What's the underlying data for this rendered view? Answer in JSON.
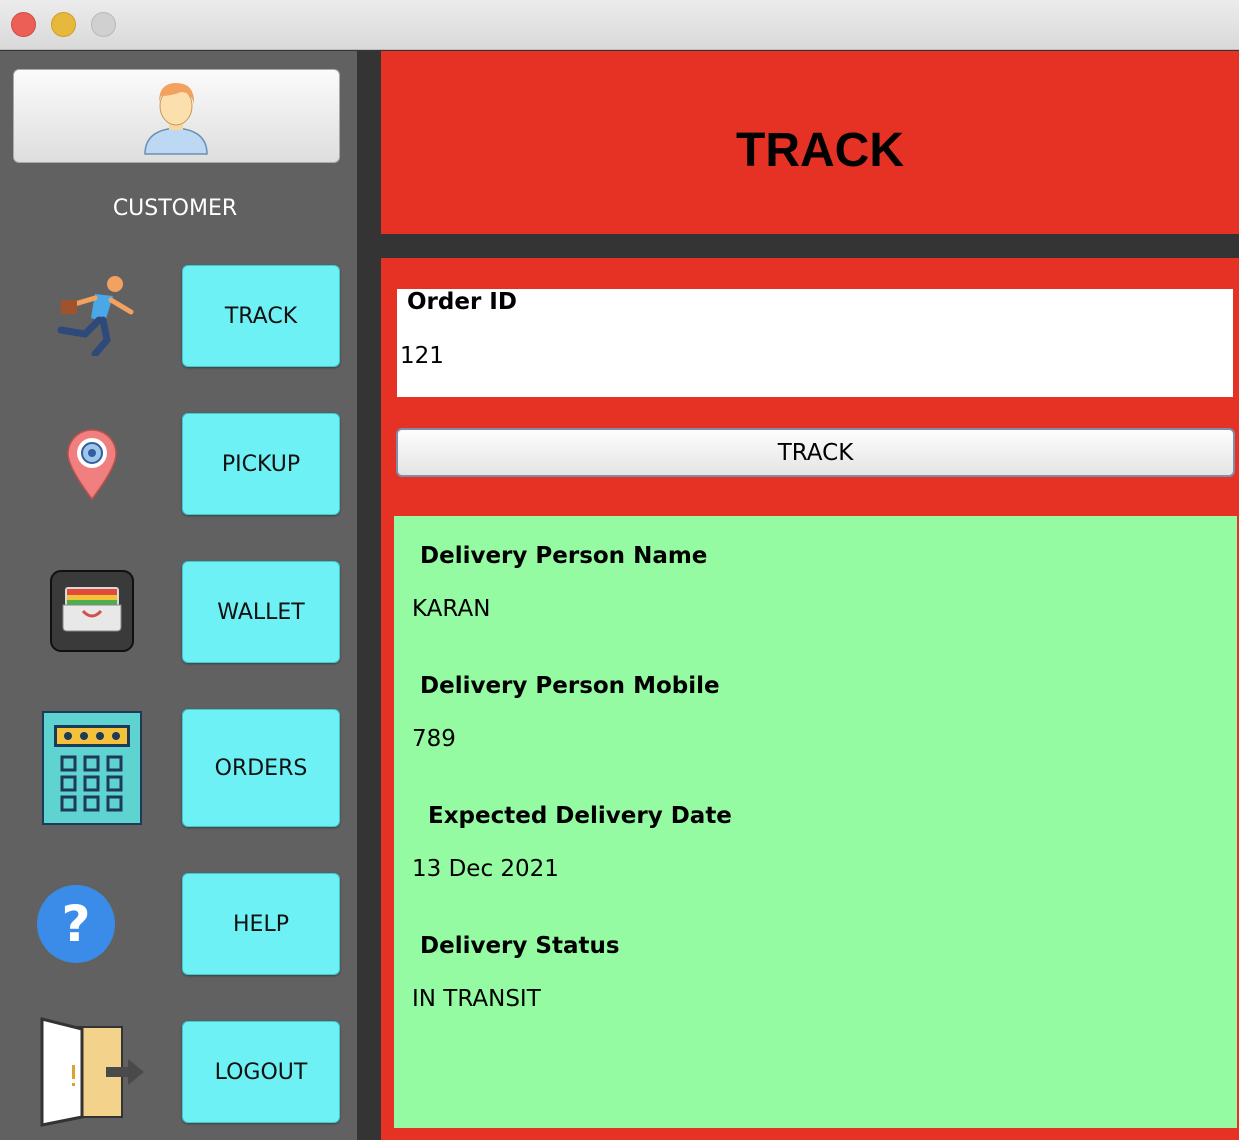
{
  "window": {
    "buttons": [
      "close",
      "minimize",
      "maximize"
    ]
  },
  "sidebar": {
    "role": "CUSTOMER",
    "profile_icon": "user-avatar-icon",
    "items": [
      {
        "label": "TRACK",
        "icon": "runner-icon"
      },
      {
        "label": "PICKUP",
        "icon": "location-pin-icon"
      },
      {
        "label": "WALLET",
        "icon": "wallet-icon"
      },
      {
        "label": "ORDERS",
        "icon": "calculator-icon"
      },
      {
        "label": "HELP",
        "icon": "help-icon"
      },
      {
        "label": "LOGOUT",
        "icon": "exit-door-icon"
      }
    ]
  },
  "header": {
    "title": "TRACK"
  },
  "form": {
    "order_id_label": "Order ID",
    "order_id_value": "121",
    "track_button": "TRACK"
  },
  "result": {
    "person_name_label": "Delivery Person Name",
    "person_name": "KARAN",
    "person_mobile_label": "Delivery Person Mobile",
    "person_mobile": "789",
    "expected_date_label": "Expected Delivery Date",
    "expected_date": "13 Dec 2021",
    "status_label": "Delivery Status",
    "status": "IN TRANSIT"
  },
  "colors": {
    "header_red": "#e63224",
    "sidebar_gray": "#616161",
    "nav_button_cyan": "#6df1f5",
    "result_green": "#94fba3"
  }
}
